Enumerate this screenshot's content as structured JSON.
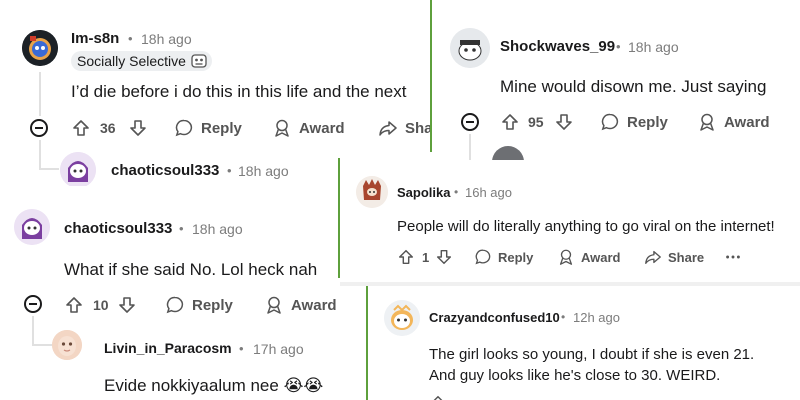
{
  "comments": {
    "im_s8n": {
      "username": "Im-s8n",
      "time": "18h ago",
      "flair": "Socially Selective",
      "flair_icon": "robot-emoji",
      "body": "I’d die before i do this in this life and the next",
      "votes": "36",
      "reply": "Reply",
      "award": "Award",
      "share": "Share",
      "share_visible": "Sha"
    },
    "chaoticsoul_reply_top": {
      "username": "chaoticsoul333",
      "time": "18h ago"
    },
    "chaoticsoul": {
      "username": "chaoticsoul333",
      "time": "18h ago",
      "body": "What if she said No. Lol heck nah",
      "votes": "10",
      "reply": "Reply",
      "award": "Award"
    },
    "livin": {
      "username": "Livin_in_Paracosm",
      "time": "17h ago",
      "body": "Evide nokkiyaalum nee",
      "emoji": "😭😭"
    },
    "shockwaves": {
      "username": "Shockwaves_99",
      "time": "18h ago",
      "body": "Mine would disown me. Just saying",
      "votes": "95",
      "reply": "Reply",
      "award": "Award"
    },
    "sapolika": {
      "username": "Sapolika",
      "time": "16h ago",
      "body": "People will do literally anything to go viral on the internet!",
      "votes": "1",
      "reply": "Reply",
      "award": "Award",
      "share": "Share"
    },
    "crazyandconfused": {
      "username": "Crazyandconfused10",
      "time": "12h ago",
      "body_line1": "The girl looks so young, I doubt if she is even 21.",
      "body_line2": "And guy looks like he's close to 30. WEIRD."
    }
  },
  "separator": "•",
  "icons": {
    "upvote": "upvote-arrow-icon",
    "downvote": "downvote-arrow-icon",
    "reply": "speech-bubble-icon",
    "award": "award-ribbon-icon",
    "share": "share-arrow-icon",
    "more": "more-dots-icon",
    "collapse": "collapse-minus-icon"
  },
  "colors": {
    "text": "#1a1a1b",
    "meta": "#7c7c7c",
    "action": "#555555",
    "divider_green": "#5ea03c"
  }
}
